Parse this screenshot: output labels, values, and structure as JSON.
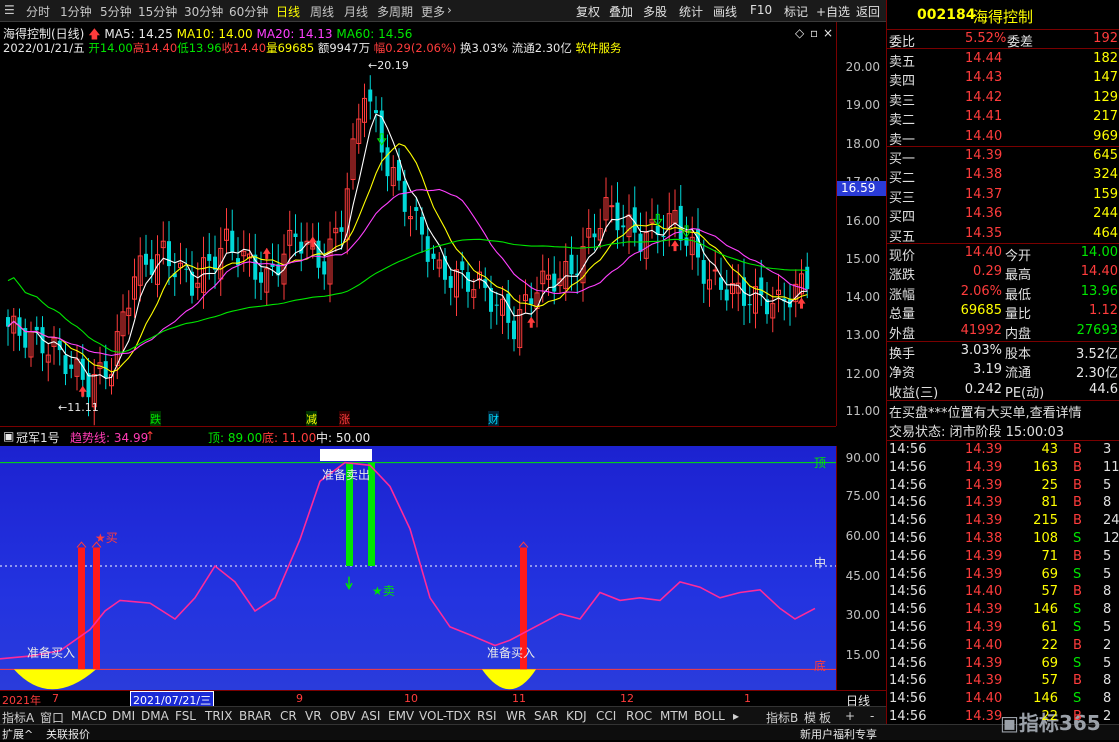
{
  "topbar": {
    "periods": [
      "分时",
      "1分钟",
      "5分钟",
      "15分钟",
      "30分钟",
      "60分钟",
      "日线",
      "周线",
      "月线",
      "多周期",
      "更多"
    ],
    "active_period": "日线",
    "right_buttons": [
      "复权",
      "叠加",
      "多股",
      "统计",
      "画线",
      "F10",
      "标记",
      "+自选",
      "返回"
    ]
  },
  "main": {
    "stock_line": "海得控制(日线)",
    "ma5": "MA5: 14.25",
    "ma10": "MA10: 14.00",
    "ma20": "MA20: 14.13",
    "ma60": "MA60: 14.56",
    "info_date": "2022/01/21/五",
    "info_open": "开14.00",
    "info_high": "高14.40",
    "info_low": "低13.96",
    "info_close": "收14.40",
    "info_vol": "量69685",
    "info_amt": "额9947万",
    "info_amp": "幅0.29(2.06%)",
    "info_turn": "换3.03%",
    "info_float": "流通2.30亿",
    "info_sector": "软件服务",
    "high_label": "20.19",
    "low_label": "11.11",
    "current_price_tag": "16.59",
    "price_ticks": [
      "20.00",
      "19.00",
      "18.00",
      "17.00",
      "16.00",
      "15.00",
      "14.00",
      "13.00",
      "12.00",
      "11.00"
    ],
    "event_markers": [
      "跌",
      "减",
      "涨",
      "财"
    ]
  },
  "indicator": {
    "name": "冠军1号",
    "trend": "趋势线: 34.99",
    "top": "顶: 89.00",
    "bottom": "底: 11.00",
    "mid": "中: 50.00",
    "ticks": [
      "90.00",
      "75.00",
      "60.00",
      "45.00",
      "30.00",
      "15.00"
    ],
    "label_top": "顶",
    "label_mid": "中",
    "label_bottom": "底",
    "buy1": "准备买入",
    "buy2": "准备买入",
    "sell": "准备卖出",
    "buy_star": "★买",
    "sell_star": "★卖"
  },
  "dateaxis": {
    "labels": [
      "2021年",
      "7",
      "2021/07/21/三",
      "9",
      "10",
      "11",
      "12",
      "1"
    ],
    "corner": "日线"
  },
  "tabs": {
    "items": [
      "指标A",
      "窗口",
      "MACD",
      "DMI",
      "DMA",
      "FSL",
      "TRIX",
      "BRAR",
      "CR",
      "VR",
      "OBV",
      "ASI",
      "EMV",
      "VOL-TDX",
      "RSI",
      "WR",
      "SAR",
      "KDJ",
      "CCI",
      "ROC",
      "MTM",
      "BOLL"
    ],
    "right_items": [
      "指标B",
      "模",
      "板",
      "+",
      "-"
    ]
  },
  "statusbar": {
    "left": [
      "扩展^",
      "关联报价"
    ],
    "right": "新用户福利专享",
    "brand": "指标365"
  },
  "quote": {
    "code": "002184",
    "name": "海得控制",
    "weibi_label": "委比",
    "weibi": "5.52%",
    "weicha_label": "委差",
    "weicha": "192",
    "asks": [
      {
        "label": "卖五",
        "price": "14.44",
        "vol": "182"
      },
      {
        "label": "卖四",
        "price": "14.43",
        "vol": "147"
      },
      {
        "label": "卖三",
        "price": "14.42",
        "vol": "129"
      },
      {
        "label": "卖二",
        "price": "14.41",
        "vol": "217"
      },
      {
        "label": "卖一",
        "price": "14.40",
        "vol": "969"
      }
    ],
    "bids": [
      {
        "label": "买一",
        "price": "14.39",
        "vol": "645"
      },
      {
        "label": "买二",
        "price": "14.38",
        "vol": "324"
      },
      {
        "label": "买三",
        "price": "14.37",
        "vol": "159"
      },
      {
        "label": "买四",
        "price": "14.36",
        "vol": "244"
      },
      {
        "label": "买五",
        "price": "14.35",
        "vol": "464"
      }
    ],
    "stats": [
      {
        "l1": "现价",
        "v1": "14.40",
        "l2": "今开",
        "v2": "14.00",
        "c1": "red",
        "c2": "grn"
      },
      {
        "l1": "涨跌",
        "v1": "0.29",
        "l2": "最高",
        "v2": "14.40",
        "c1": "red",
        "c2": "red"
      },
      {
        "l1": "涨幅",
        "v1": "2.06%",
        "l2": "最低",
        "v2": "13.96",
        "c1": "red",
        "c2": "grn"
      },
      {
        "l1": "总量",
        "v1": "69685",
        "l2": "量比",
        "v2": "1.12",
        "c1": "yel",
        "c2": "red"
      },
      {
        "l1": "外盘",
        "v1": "41992",
        "l2": "内盘",
        "v2": "27693",
        "c1": "red",
        "c2": "grn"
      }
    ],
    "stats2": [
      {
        "l1": "换手",
        "v1": "3.03%",
        "l2": "股本",
        "v2": "3.52亿"
      },
      {
        "l1": "净资",
        "v1": "3.19",
        "l2": "流通",
        "v2": "2.30亿"
      },
      {
        "l1": "收益(三)",
        "v1": "0.242",
        "l2": "PE(动)",
        "v2": "44.6"
      }
    ],
    "notice": "在买盘***位置有大买单,查看详情",
    "status": "交易状态: 闭市阶段 15:00:03",
    "ticks": [
      {
        "t": "14:56",
        "p": "14.39",
        "v": "43",
        "s": "B",
        "n": "3"
      },
      {
        "t": "14:56",
        "p": "14.39",
        "v": "163",
        "s": "B",
        "n": "11"
      },
      {
        "t": "14:56",
        "p": "14.39",
        "v": "25",
        "s": "B",
        "n": "5"
      },
      {
        "t": "14:56",
        "p": "14.39",
        "v": "81",
        "s": "B",
        "n": "8"
      },
      {
        "t": "14:56",
        "p": "14.39",
        "v": "215",
        "s": "B",
        "n": "24"
      },
      {
        "t": "14:56",
        "p": "14.38",
        "v": "108",
        "s": "S",
        "n": "12"
      },
      {
        "t": "14:56",
        "p": "14.39",
        "v": "71",
        "s": "B",
        "n": "5"
      },
      {
        "t": "14:56",
        "p": "14.39",
        "v": "69",
        "s": "S",
        "n": "5"
      },
      {
        "t": "14:56",
        "p": "14.40",
        "v": "57",
        "s": "B",
        "n": "8"
      },
      {
        "t": "14:56",
        "p": "14.39",
        "v": "146",
        "s": "S",
        "n": "8"
      },
      {
        "t": "14:56",
        "p": "14.39",
        "v": "61",
        "s": "S",
        "n": "5"
      },
      {
        "t": "14:56",
        "p": "14.40",
        "v": "22",
        "s": "B",
        "n": "2"
      },
      {
        "t": "14:56",
        "p": "14.39",
        "v": "69",
        "s": "S",
        "n": "5"
      },
      {
        "t": "14:56",
        "p": "14.39",
        "v": "57",
        "s": "B",
        "n": "8"
      },
      {
        "t": "14:56",
        "p": "14.40",
        "v": "146",
        "s": "S",
        "n": "8"
      },
      {
        "t": "14:56",
        "p": "14.39",
        "v": "22",
        "s": "B",
        "n": "2"
      }
    ]
  },
  "colors": {
    "up": "#ff3c3c",
    "down": "#00e600",
    "accent": "#ffff00",
    "panel_border": "#7a0000",
    "indicator_bg": "#2333e0",
    "trend_line": "#ff2a9a"
  }
}
